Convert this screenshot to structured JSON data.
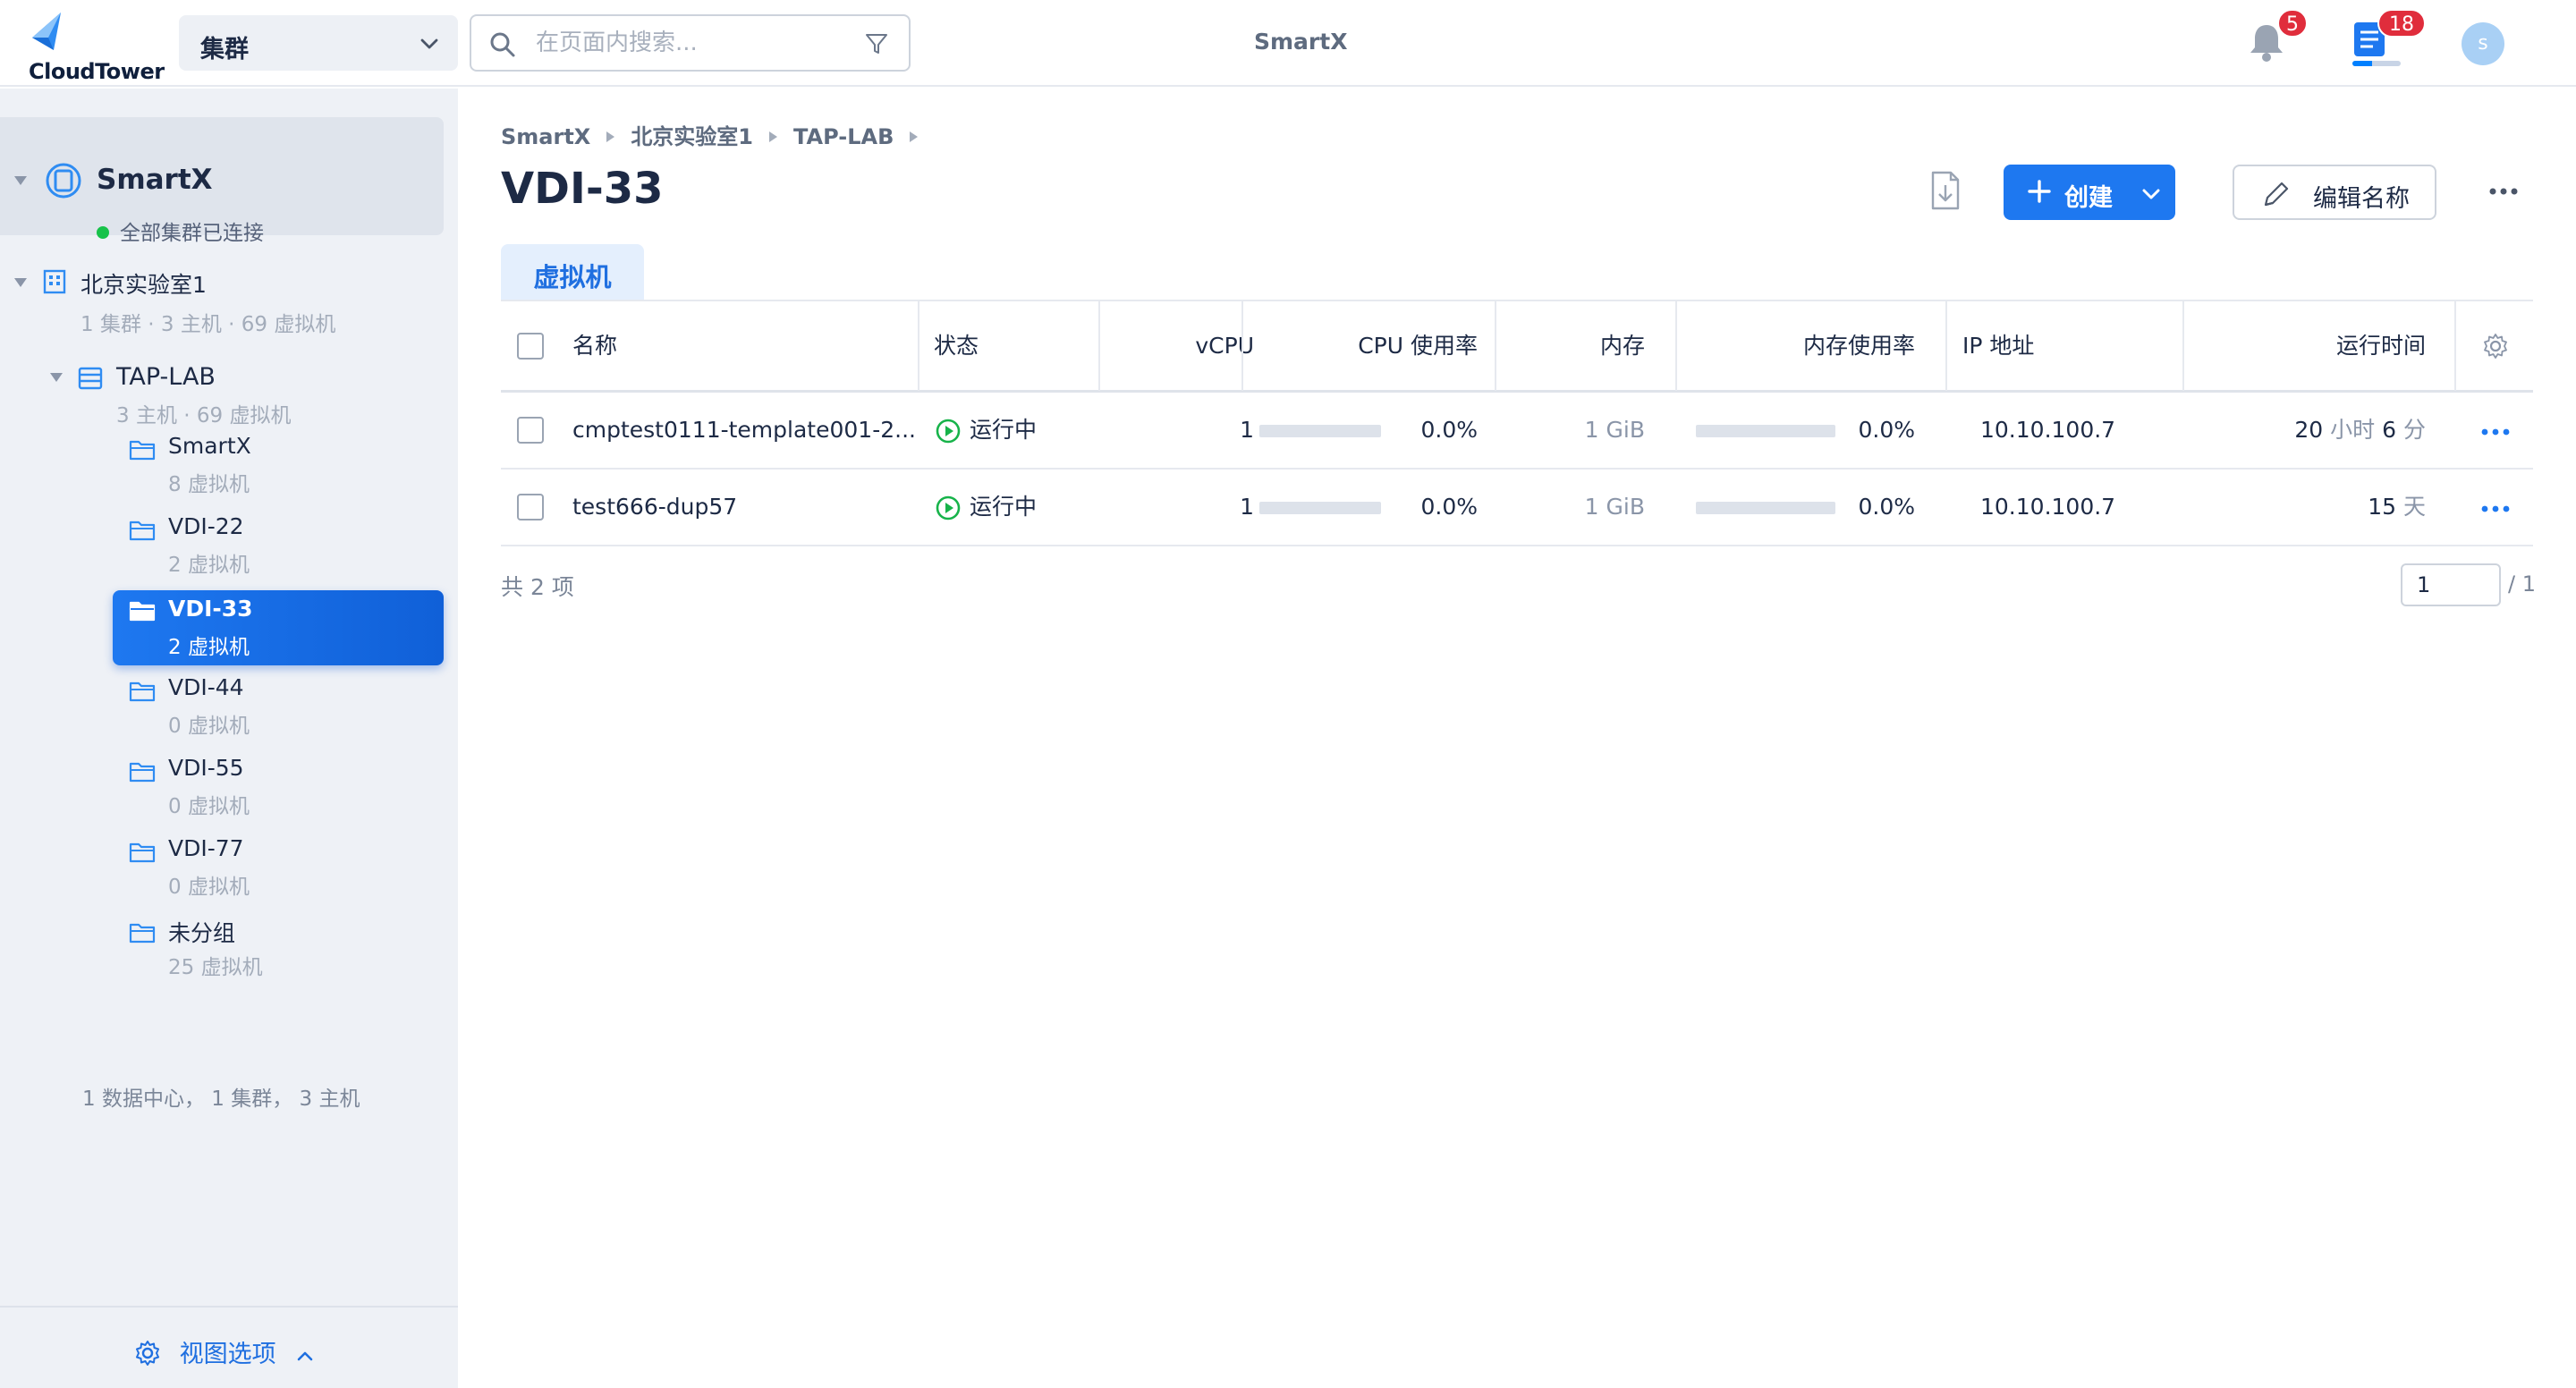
{
  "app": {
    "logo_text": "CloudTower",
    "cluster_select": "集群",
    "search_placeholder": "在页面内搜索...",
    "top_center_title": "SmartX",
    "notifications_count": "5",
    "tasks_count": "18",
    "tasks_progress": 0.4,
    "avatar_initial": "s"
  },
  "sidebar": {
    "org_name": "SmartX",
    "org_status": "全部集群已连接",
    "datacenter": {
      "name": "北京实验室1",
      "stats": "1 集群 · 3 主机 · 69 虚拟机"
    },
    "cluster": {
      "name": "TAP-LAB",
      "stats": "3 主机 · 69 虚拟机"
    },
    "folders": [
      {
        "name": "SmartX",
        "count": "8 虚拟机",
        "active": false
      },
      {
        "name": "VDI-22",
        "count": "2 虚拟机",
        "active": false
      },
      {
        "name": "VDI-33",
        "count": "2 虚拟机",
        "active": true
      },
      {
        "name": "VDI-44",
        "count": "0 虚拟机",
        "active": false
      },
      {
        "name": "VDI-55",
        "count": "0 虚拟机",
        "active": false
      },
      {
        "name": "VDI-77",
        "count": "0 虚拟机",
        "active": false
      },
      {
        "name": "未分组",
        "count": "25 虚拟机",
        "active": false
      }
    ],
    "summary": "1 数据中心， 1 集群， 3 主机",
    "view_options": "视图选项"
  },
  "main": {
    "breadcrumb": [
      "SmartX",
      "北京实验室1",
      "TAP-LAB"
    ],
    "title": "VDI-33",
    "create_label": "创建",
    "edit_label": "编辑名称",
    "tab_label": "虚拟机",
    "columns": {
      "name": "名称",
      "status": "状态",
      "vcpu": "vCPU",
      "cpu_usage": "CPU 使用率",
      "memory": "内存",
      "mem_usage": "内存使用率",
      "ip": "IP 地址",
      "uptime": "运行时间"
    },
    "rows": [
      {
        "name": "cmptest0111-template001-2...",
        "status": "运行中",
        "vcpu": "1",
        "cpu_usage": "0.0%",
        "cpu_usage_value": 0.0,
        "memory_num": "1",
        "memory_unit": "GiB",
        "mem_usage": "0.0%",
        "mem_usage_value": 0.0,
        "ip": "10.10.100.7",
        "uptime_a_num": "20",
        "uptime_a_unit": "小时",
        "uptime_b_num": "6",
        "uptime_b_unit": "分"
      },
      {
        "name": "test666-dup57",
        "status": "运行中",
        "vcpu": "1",
        "cpu_usage": "0.0%",
        "cpu_usage_value": 0.0,
        "memory_num": "1",
        "memory_unit": "GiB",
        "mem_usage": "0.0%",
        "mem_usage_value": 0.0,
        "ip": "10.10.100.7",
        "uptime_a_num": "15",
        "uptime_a_unit": "天",
        "uptime_b_num": "",
        "uptime_b_unit": ""
      }
    ],
    "total_label": "共 2 项",
    "page_value": "1",
    "page_total": "/ 1"
  },
  "colors": {
    "accent": "#1e78f0",
    "running": "#17b34a",
    "badge": "#e02d3c",
    "sidebar_bg": "#eef1f6"
  }
}
